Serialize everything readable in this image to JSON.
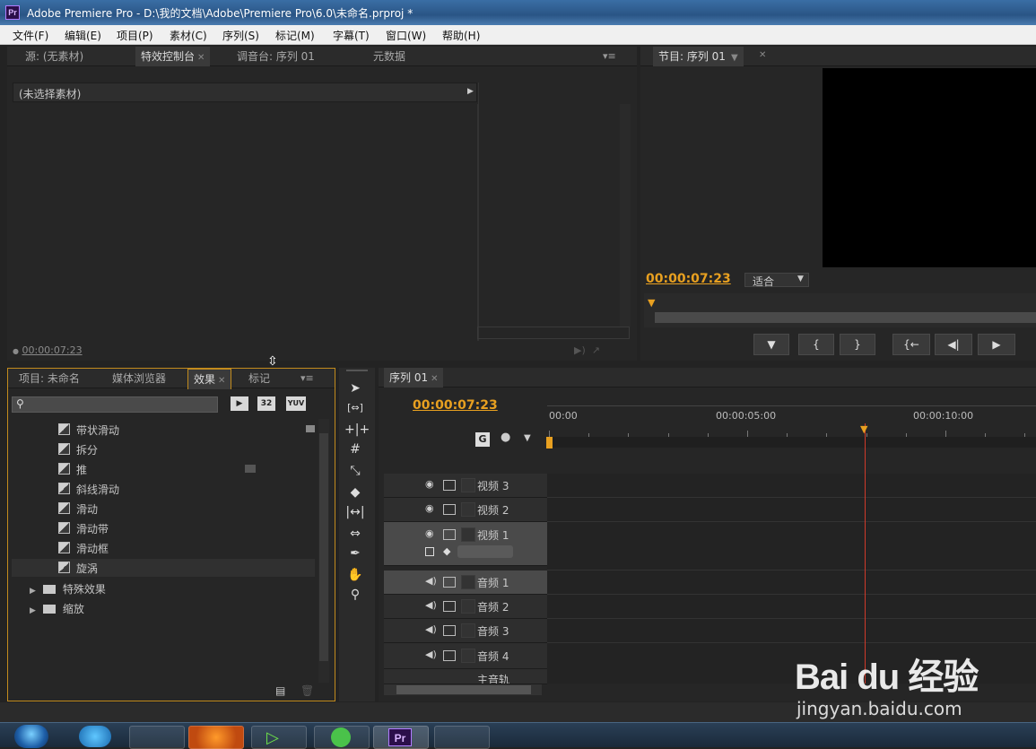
{
  "window": {
    "app_icon": "Pr",
    "title": "Adobe Premiere Pro - D:\\我的文档\\Adobe\\Premiere Pro\\6.0\\未命名.prproj *"
  },
  "menu": [
    "文件(F)",
    "编辑(E)",
    "项目(P)",
    "素材(C)",
    "序列(S)",
    "标记(M)",
    "字幕(T)",
    "窗口(W)",
    "帮助(H)"
  ],
  "source_panel": {
    "tabs": [
      "源: (无素材)",
      "特效控制台",
      "调音台: 序列 01",
      "元数据"
    ],
    "active_tab": "特效控制台",
    "clip_header": "(未选择素材)",
    "timecode": "00:00:07:23"
  },
  "program_panel": {
    "tab": "节目: 序列 01",
    "timecode": "00:00:07:23",
    "fit_value": "适合"
  },
  "project_panel": {
    "tabs": [
      "项目: 未命名",
      "媒体浏览器",
      "效果",
      "标记"
    ],
    "active_tab": "效果",
    "search_placeholder": "",
    "badges": [
      "32",
      "YUV"
    ],
    "effects": [
      "带状滑动",
      "拆分",
      "推",
      "斜线滑动",
      "滑动",
      "滑动带",
      "滑动框",
      "旋涡"
    ],
    "folders": [
      "特殊效果",
      "缩放"
    ]
  },
  "timeline": {
    "tab": "序列 01",
    "timecode": "00:00:07:23",
    "ruler_labels": [
      "00:00",
      "00:00:05:00",
      "00:00:10:00"
    ],
    "playhead_seconds": 7.96,
    "tracks": [
      {
        "name": "视频 3",
        "kind": "video"
      },
      {
        "name": "视频 2",
        "kind": "video"
      },
      {
        "name": "视频 1",
        "kind": "video",
        "expanded": true
      },
      {
        "name": "音频 1",
        "kind": "audio",
        "selected": true
      },
      {
        "name": "音频 2",
        "kind": "audio"
      },
      {
        "name": "音频 3",
        "kind": "audio"
      },
      {
        "name": "音频 4",
        "kind": "audio"
      },
      {
        "name": "主音轨",
        "kind": "master"
      }
    ]
  },
  "watermark": {
    "logo": "Bai du 经验",
    "url": "jingyan.baidu.com"
  },
  "taskbar": {
    "items": [
      "start-orb",
      "media-player",
      "explorer",
      "firefox",
      "app-green",
      "app-360",
      "premiere",
      "app-window"
    ],
    "pr_label": "Pr"
  },
  "colors": {
    "accent": "#e8a020",
    "playhead": "#d03a2a",
    "panel": "#262626",
    "menubar": "#f0f0f0"
  }
}
